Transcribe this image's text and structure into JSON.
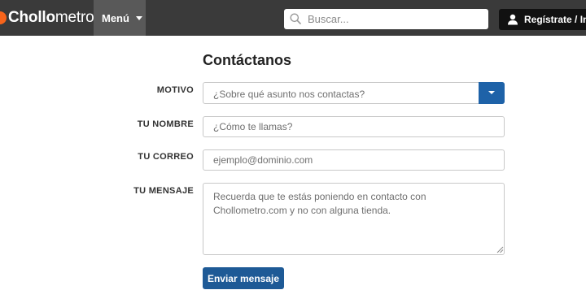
{
  "header": {
    "logo_bold": "Chollo",
    "logo_light": "metro",
    "menu_label": "Menú",
    "search_placeholder": "Buscar...",
    "register_label": "Regístrate / Inic",
    "brand_color": "#f7641b",
    "bar_color": "#3a3a3a"
  },
  "form": {
    "title": "Contáctanos",
    "motivo": {
      "label": "MOTIVO",
      "placeholder": "¿Sobre qué asunto nos contactas?"
    },
    "nombre": {
      "label": "TU NOMBRE",
      "placeholder": "¿Cómo te llamas?"
    },
    "correo": {
      "label": "TU CORREO",
      "placeholder": "ejemplo@dominio.com"
    },
    "mensaje": {
      "label": "TU MENSAJE",
      "placeholder": "Recuerda que te estás poniendo en contacto con Chollometro.com y no con alguna tienda."
    },
    "submit_label": "Enviar mensaje",
    "accent_color": "#1e62a8"
  },
  "icons": {
    "logo": "chollometro-flame-icon",
    "menu": "caret-down-icon",
    "search": "search-icon",
    "user": "user-icon",
    "select": "caret-down-icon",
    "resize": "resize-grip-icon"
  }
}
